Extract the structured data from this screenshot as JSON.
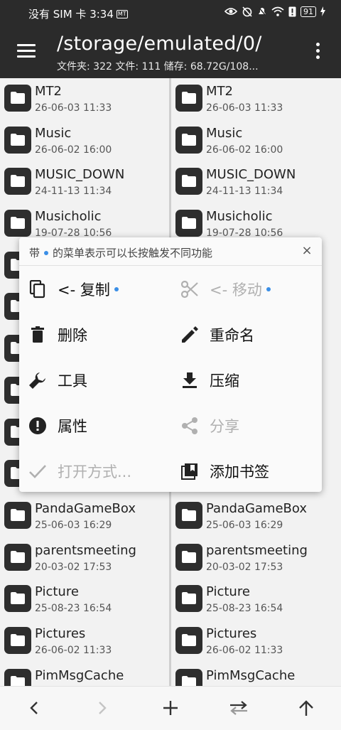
{
  "status_bar": {
    "carrier_time": "没有 SIM 卡 3:34",
    "notification_badge": "MT",
    "battery": "91"
  },
  "app_bar": {
    "title": "/storage/emulated/0/",
    "subtitle": "文件夹: 322  文件: 111  储存: 68.72G/108..."
  },
  "files": [
    {
      "name": "MT2",
      "date": "26-06-03 11:33"
    },
    {
      "name": "Music",
      "date": "26-06-02 16:00"
    },
    {
      "name": "MUSIC_DOWN",
      "date": "24-11-13 11:34"
    },
    {
      "name": "Musicholic",
      "date": "19-07-28 10:56"
    },
    {
      "name": "",
      "date": ""
    },
    {
      "name": "",
      "date": ""
    },
    {
      "name": "",
      "date": ""
    },
    {
      "name": "",
      "date": ""
    },
    {
      "name": "",
      "date": ""
    },
    {
      "name": "",
      "date": ""
    },
    {
      "name": "PandaGameBox",
      "date": "25-06-03 16:29"
    },
    {
      "name": "parentsmeeting",
      "date": "20-03-02 17:53"
    },
    {
      "name": "Picture",
      "date": "25-08-23 16:54"
    },
    {
      "name": "Pictures",
      "date": "26-06-02 11:33"
    },
    {
      "name": "PimMsgCache",
      "date": ""
    }
  ],
  "popup": {
    "hint_prefix": "带",
    "hint_suffix": "的菜单表示可以长按触发不同功能",
    "close_label": "×",
    "items": [
      {
        "label": "<- 复制",
        "icon": "copy-icon",
        "disabled": false,
        "dot": true
      },
      {
        "label": "<- 移动",
        "icon": "cut-icon",
        "disabled": true,
        "dot": true
      },
      {
        "label": "删除",
        "icon": "delete-icon",
        "disabled": false,
        "dot": false
      },
      {
        "label": "重命名",
        "icon": "edit-icon",
        "disabled": false,
        "dot": false
      },
      {
        "label": "工具",
        "icon": "wrench-icon",
        "disabled": false,
        "dot": false
      },
      {
        "label": "压缩",
        "icon": "download-icon",
        "disabled": false,
        "dot": false
      },
      {
        "label": "属性",
        "icon": "info-icon",
        "disabled": false,
        "dot": false
      },
      {
        "label": "分享",
        "icon": "share-icon",
        "disabled": true,
        "dot": false
      },
      {
        "label": "打开方式...",
        "icon": "check-icon",
        "disabled": true,
        "dot": false
      },
      {
        "label": "添加书签",
        "icon": "bookmark-icon",
        "disabled": false,
        "dot": false
      }
    ]
  },
  "bottom_nav": [
    "back-icon",
    "forward-icon",
    "add-icon",
    "swap-icon",
    "up-icon"
  ],
  "colors": {
    "accent_dot": "#3a8ee6",
    "app_bar": "#2b2b2b",
    "disabled": "#b0b0b0"
  }
}
